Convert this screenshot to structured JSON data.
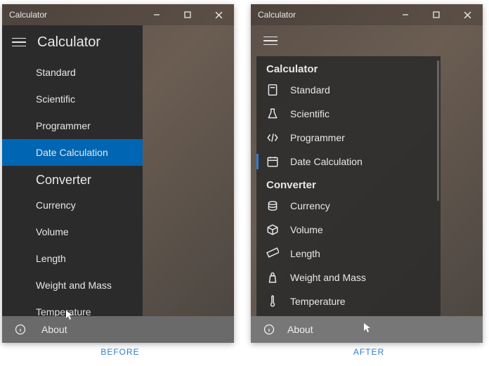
{
  "captions": {
    "before": "BEFORE",
    "after": "AFTER"
  },
  "before": {
    "window_title": "Calculator",
    "header": "Calculator",
    "sections": {
      "calculator": {
        "items": [
          "Standard",
          "Scientific",
          "Programmer",
          "Date Calculation"
        ],
        "selected_index": 3
      },
      "converter": {
        "header": "Converter",
        "items": [
          "Currency",
          "Volume",
          "Length",
          "Weight and Mass",
          "Temperature"
        ]
      }
    },
    "about": "About"
  },
  "after": {
    "window_title": "Calculator",
    "sections": {
      "calculator": {
        "header": "Calculator",
        "items": [
          {
            "label": "Standard",
            "icon": "calculator-icon"
          },
          {
            "label": "Scientific",
            "icon": "flask-icon"
          },
          {
            "label": "Programmer",
            "icon": "code-icon"
          },
          {
            "label": "Date Calculation",
            "icon": "calendar-icon"
          }
        ],
        "selected_index": 3
      },
      "converter": {
        "header": "Converter",
        "items": [
          {
            "label": "Currency",
            "icon": "currency-icon"
          },
          {
            "label": "Volume",
            "icon": "cube-icon"
          },
          {
            "label": "Length",
            "icon": "ruler-icon"
          },
          {
            "label": "Weight and Mass",
            "icon": "weight-icon"
          },
          {
            "label": "Temperature",
            "icon": "thermometer-icon"
          }
        ]
      }
    },
    "about": "About"
  }
}
